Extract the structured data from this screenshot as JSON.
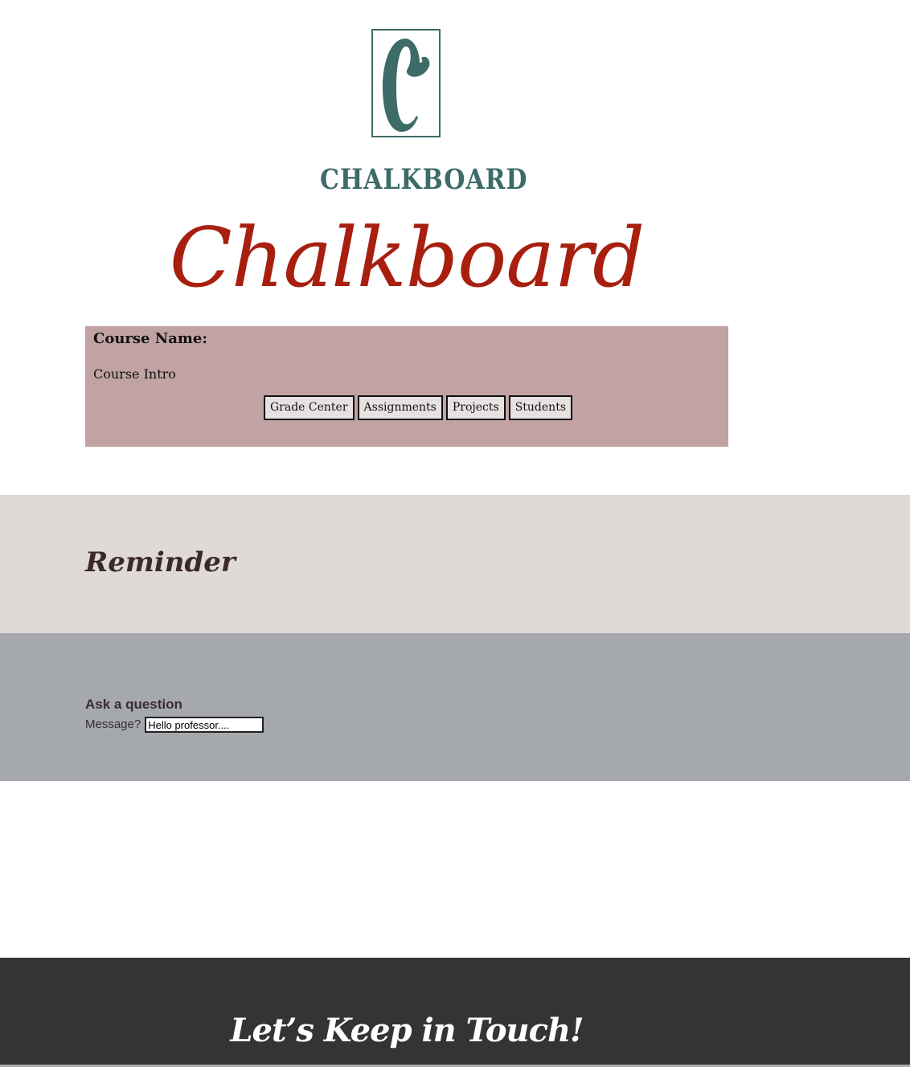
{
  "logo": {
    "letter": "C",
    "wordmark": "CHALKBOARD",
    "color": "#3d6b67"
  },
  "header": {
    "title": "Chalkboard",
    "title_color": "#a81f0f"
  },
  "course": {
    "name_label": "Course Name:",
    "intro": "Course Intro",
    "background": "#c1a3a3",
    "nav": [
      {
        "label": "Grade Center"
      },
      {
        "label": "Assignments"
      },
      {
        "label": "Projects"
      },
      {
        "label": "Students"
      }
    ]
  },
  "reminder": {
    "title": "Reminder",
    "background": "#dfd9d7"
  },
  "question": {
    "title": "Ask a question",
    "message_label": "Message?",
    "message_value": "Hello professor....",
    "background": "#a5a9ad"
  },
  "footer": {
    "title": "Let’s Keep in Touch!",
    "background": "#343434"
  }
}
